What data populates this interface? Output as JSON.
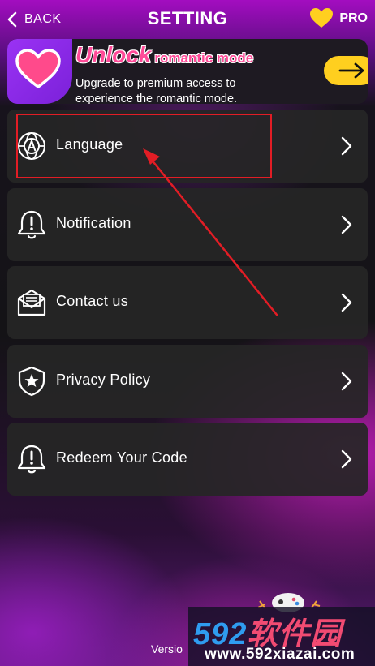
{
  "header": {
    "back_label": "BACK",
    "title": "SETTING",
    "pro_label": "PRO"
  },
  "banner": {
    "title_big": "Unlock",
    "title_small": "romantic mode",
    "subtitle": "Upgrade to premium access to experience the romantic mode."
  },
  "settings": {
    "items": [
      {
        "label": "Language",
        "icon": "language-icon"
      },
      {
        "label": "Notification",
        "icon": "bell-alert-icon"
      },
      {
        "label": "Contact us",
        "icon": "envelope-icon"
      },
      {
        "label": "Privacy Policy",
        "icon": "shield-star-icon"
      },
      {
        "label": "Redeem Your Code",
        "icon": "bell-alert-icon"
      }
    ]
  },
  "footer": {
    "version_label": "Versio"
  },
  "watermark": {
    "logo_number": "592",
    "logo_text": "软件园",
    "url": "www.592xiazai.com"
  },
  "colors": {
    "accent_pink": "#ff4a98",
    "accent_yellow": "#ffcf1f",
    "banner_purple": "#8a2be2",
    "annotation_red": "#e21d25",
    "row_background": "#262626"
  }
}
